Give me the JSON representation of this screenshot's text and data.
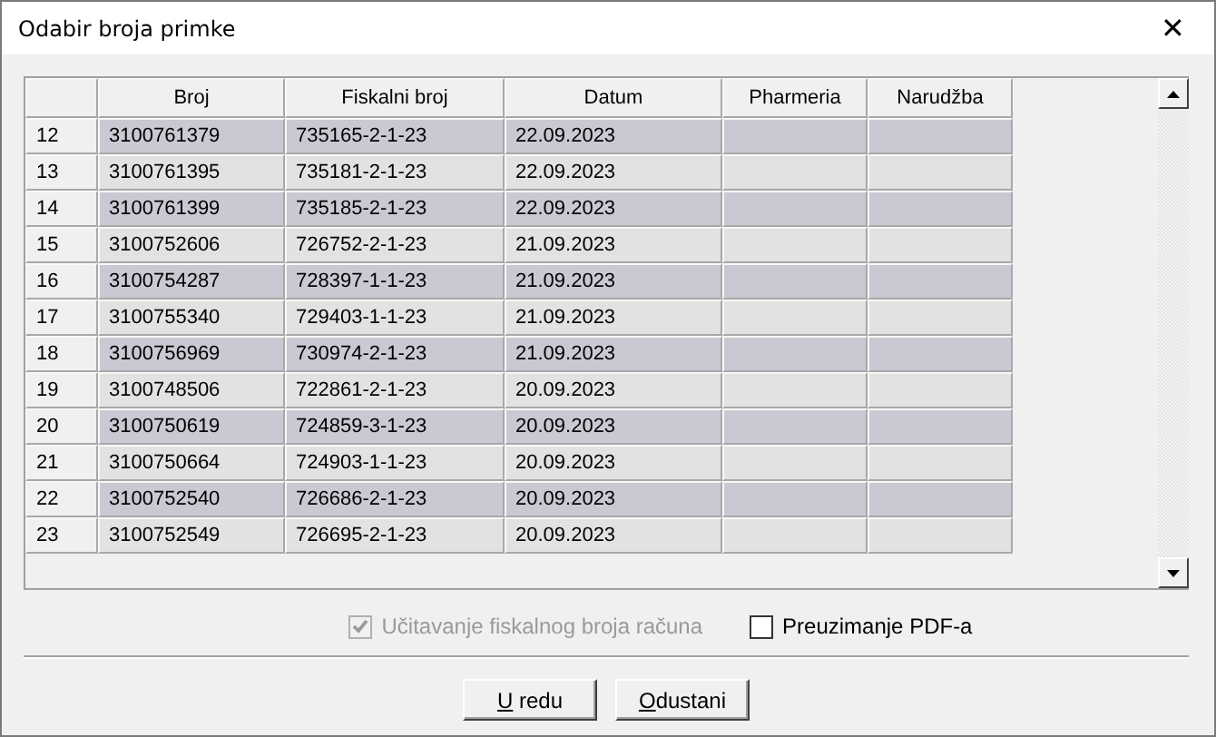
{
  "window": {
    "title": "Odabir broja primke",
    "close": "✕"
  },
  "table": {
    "columns": [
      "Broj",
      "Fiskalni broj",
      "Datum",
      "Pharmeria",
      "Narudžba"
    ],
    "rows": [
      {
        "index": "12",
        "cells": [
          "3100761379",
          "735165-2-1-23",
          "22.09.2023",
          "",
          ""
        ]
      },
      {
        "index": "13",
        "cells": [
          "3100761395",
          "735181-2-1-23",
          "22.09.2023",
          "",
          ""
        ]
      },
      {
        "index": "14",
        "cells": [
          "3100761399",
          "735185-2-1-23",
          "22.09.2023",
          "",
          ""
        ]
      },
      {
        "index": "15",
        "cells": [
          "3100752606",
          "726752-2-1-23",
          "21.09.2023",
          "",
          ""
        ]
      },
      {
        "index": "16",
        "cells": [
          "3100754287",
          "728397-1-1-23",
          "21.09.2023",
          "",
          ""
        ]
      },
      {
        "index": "17",
        "cells": [
          "3100755340",
          "729403-1-1-23",
          "21.09.2023",
          "",
          ""
        ]
      },
      {
        "index": "18",
        "cells": [
          "3100756969",
          "730974-2-1-23",
          "21.09.2023",
          "",
          ""
        ]
      },
      {
        "index": "19",
        "cells": [
          "3100748506",
          "722861-2-1-23",
          "20.09.2023",
          "",
          ""
        ]
      },
      {
        "index": "20",
        "cells": [
          "3100750619",
          "724859-3-1-23",
          "20.09.2023",
          "",
          ""
        ]
      },
      {
        "index": "21",
        "cells": [
          "3100750664",
          "724903-1-1-23",
          "20.09.2023",
          "",
          ""
        ]
      },
      {
        "index": "22",
        "cells": [
          "3100752540",
          "726686-2-1-23",
          "20.09.2023",
          "",
          ""
        ]
      },
      {
        "index": "23",
        "cells": [
          "3100752549",
          "726695-2-1-23",
          "20.09.2023",
          "",
          ""
        ]
      }
    ]
  },
  "options": [
    {
      "label": "Učitavanje fiskalnog broja računa",
      "checked": true,
      "disabled": true
    },
    {
      "label": "Preuzimanje PDF-a",
      "checked": false,
      "disabled": false
    }
  ],
  "buttons": [
    {
      "accel": "U",
      "rest": " redu"
    },
    {
      "accel": "O",
      "rest": "dustani"
    }
  ]
}
